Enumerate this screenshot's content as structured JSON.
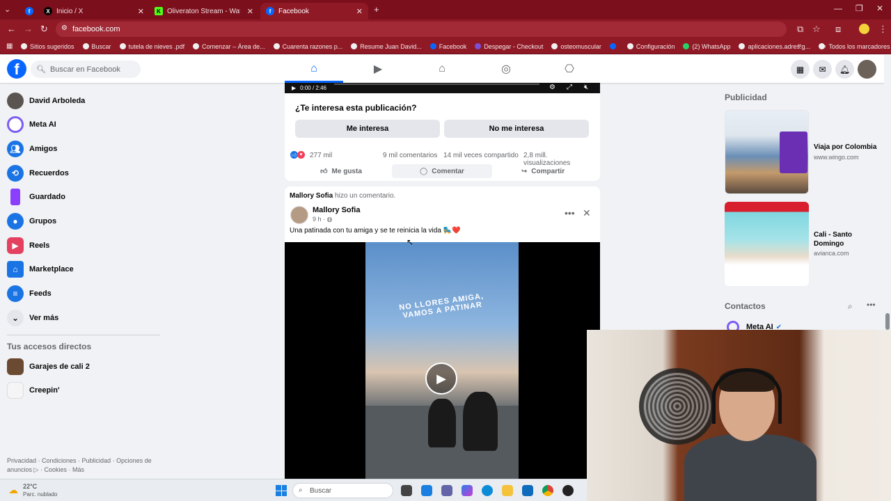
{
  "browser": {
    "tabs": [
      {
        "title": "",
        "favicon": "facebook-icon"
      },
      {
        "title": "Inicio / X",
        "favicon": "x-icon"
      },
      {
        "title": "Oliveraton Stream - Watch",
        "favicon": "kick-icon"
      },
      {
        "title": "Facebook",
        "favicon": "facebook-icon"
      }
    ],
    "address": "facebook.com",
    "bookmarks": [
      "Sitios sugeridos",
      "Buscar",
      "tutela de nieves .pdf",
      "Comenzar – Área de...",
      "Cuarenta razones p...",
      "Resume Juan David...",
      "Facebook",
      "Despegar - Checkout",
      "osteomuscular",
      "",
      "Configuración",
      "(2) WhatsApp",
      "aplicaciones.adres.g..."
    ],
    "all_bookmarks": "Todos los marcadores"
  },
  "header": {
    "search_placeholder": "Buscar en Facebook"
  },
  "sidebar": {
    "items": [
      {
        "label": "David Arboleda",
        "icon": "profile-avatar"
      },
      {
        "label": "Meta AI",
        "icon": "meta-ai-icon"
      },
      {
        "label": "Amigos",
        "icon": "friends-icon"
      },
      {
        "label": "Recuerdos",
        "icon": "memories-icon"
      },
      {
        "label": "Guardado",
        "icon": "saved-icon"
      },
      {
        "label": "Grupos",
        "icon": "groups-icon"
      },
      {
        "label": "Reels",
        "icon": "reels-icon"
      },
      {
        "label": "Marketplace",
        "icon": "marketplace-icon"
      },
      {
        "label": "Feeds",
        "icon": "feeds-icon"
      },
      {
        "label": "Ver más",
        "icon": "chevron-down-icon"
      }
    ],
    "shortcuts_title": "Tus accesos directos",
    "shortcuts": [
      {
        "label": "Garajes de cali 2"
      },
      {
        "label": "Creepin'"
      }
    ],
    "footer": "Privacidad · Condiciones · Publicidad · Opciones de anuncios ▷ · Cookies · Más"
  },
  "prev_post": {
    "video_time": "0:00 / 2:46",
    "question": "¿Te interesa esta publicación?",
    "interested": "Me interesa",
    "not_interested": "No me interesa",
    "reactions": "277 mil",
    "comments": "9 mil comentarios",
    "shares": "14 mil veces compartido",
    "views": "2,8 mill. visualizaciones",
    "like": "Me gusta",
    "comment": "Comentar",
    "share": "Compartir"
  },
  "post": {
    "commenter": "Mallory Sofia",
    "commenter_action": "hizo un comentario.",
    "author": "Mallory Sofia",
    "time": "9 h ·",
    "caption": "Una patinada con tu amiga y se te reinicia la vida 🛼❤️",
    "video_overlay_text": "NO LLORES AMIGA, VAMOS A PATINAR"
  },
  "ads": {
    "title": "Publicidad",
    "items": [
      {
        "title": "Viaja por Colombia",
        "source": "www.wingo.com"
      },
      {
        "title": "Cali - Santo Domingo",
        "source": "avianca.com"
      }
    ]
  },
  "contacts": {
    "title": "Contactos",
    "first": "Meta AI"
  },
  "taskbar": {
    "temp": "22°C",
    "weather": "Parc. nublado",
    "search": "Buscar"
  },
  "colors": {
    "fb_blue": "#0866ff",
    "browser_frame": "#8f1a26"
  }
}
